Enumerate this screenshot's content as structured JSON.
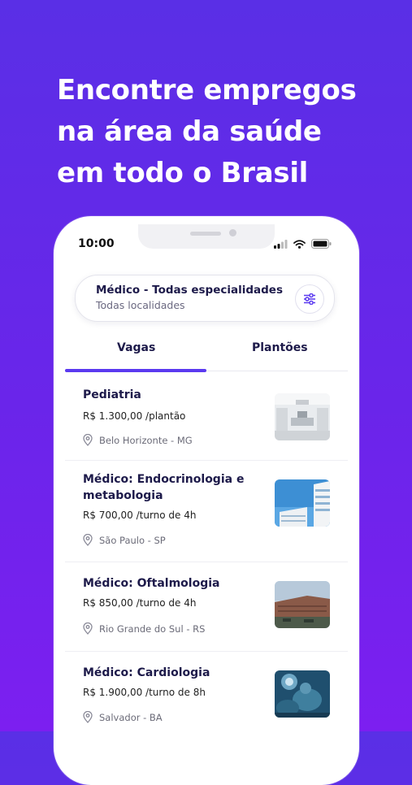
{
  "headline": {
    "line1": "Encontre empregos",
    "line2": "na área da saúde",
    "line3": "em todo o Brasil"
  },
  "status_bar": {
    "time": "10:00"
  },
  "search": {
    "title": "Médico - Todas especialidades",
    "subtitle": "Todas localidades"
  },
  "tabs": [
    {
      "label": "Vagas",
      "active": true
    },
    {
      "label": "Plantões",
      "active": false
    }
  ],
  "jobs": [
    {
      "title": "Pediatria",
      "price": "R$ 1.300,00 /plantão",
      "location": "Belo Horizonte - MG",
      "image": "hospital-interior-photo"
    },
    {
      "title": "Médico: Endocrinologia e metabologia",
      "price": "R$ 700,00 /turno de 4h",
      "location": "São Paulo - SP",
      "image": "hospital-building-photo"
    },
    {
      "title": "Médico: Oftalmologia",
      "price": "R$ 850,00 /turno de 4h",
      "location": "Rio Grande do Sul - RS",
      "image": "hospital-exterior-photo"
    },
    {
      "title": "Médico: Cardiologia",
      "price": "R$ 1.900,00 /turno de 8h",
      "location": "Salvador - BA",
      "image": "surgery-photo"
    }
  ],
  "colors": {
    "background": "#6227ea",
    "accent": "#5b3af0",
    "title_text": "#1d1a4a"
  }
}
